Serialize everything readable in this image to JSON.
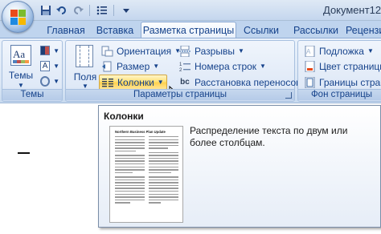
{
  "window": {
    "title": "Документ12 -"
  },
  "quick_access": {
    "items": [
      "save-icon",
      "undo-icon",
      "redo-icon",
      "bullets-icon",
      "customize-icon"
    ]
  },
  "tabs": [
    {
      "label": "Главная",
      "active": false
    },
    {
      "label": "Вставка",
      "active": false
    },
    {
      "label": "Разметка страницы",
      "active": true
    },
    {
      "label": "Ссылки",
      "active": false
    },
    {
      "label": "Рассылки",
      "active": false
    },
    {
      "label": "Рецензир",
      "active": false
    }
  ],
  "ribbon": {
    "themes": {
      "group_label": "Темы",
      "themes_button": "Темы",
      "themes_icon_text": "Aa"
    },
    "page_setup": {
      "group_label": "Параметры страницы",
      "margins_button": "Поля",
      "orientation": "Ориентация",
      "size": "Размер",
      "columns": "Колонки",
      "breaks": "Разрывы",
      "line_numbers": "Номера строк",
      "hyphenation": "Расстановка переносов"
    },
    "page_background": {
      "group_label": "Фон страницы",
      "watermark": "Подложка",
      "page_color": "Цвет страницы",
      "page_borders": "Границы страни"
    }
  },
  "tooltip": {
    "title": "Колонки",
    "description": "Распределение текста по двум или более столбцам.",
    "preview_title": "Northern Business Plan Update"
  },
  "colors": {
    "accent": "#15428b",
    "highlight": "#ffd14f"
  }
}
